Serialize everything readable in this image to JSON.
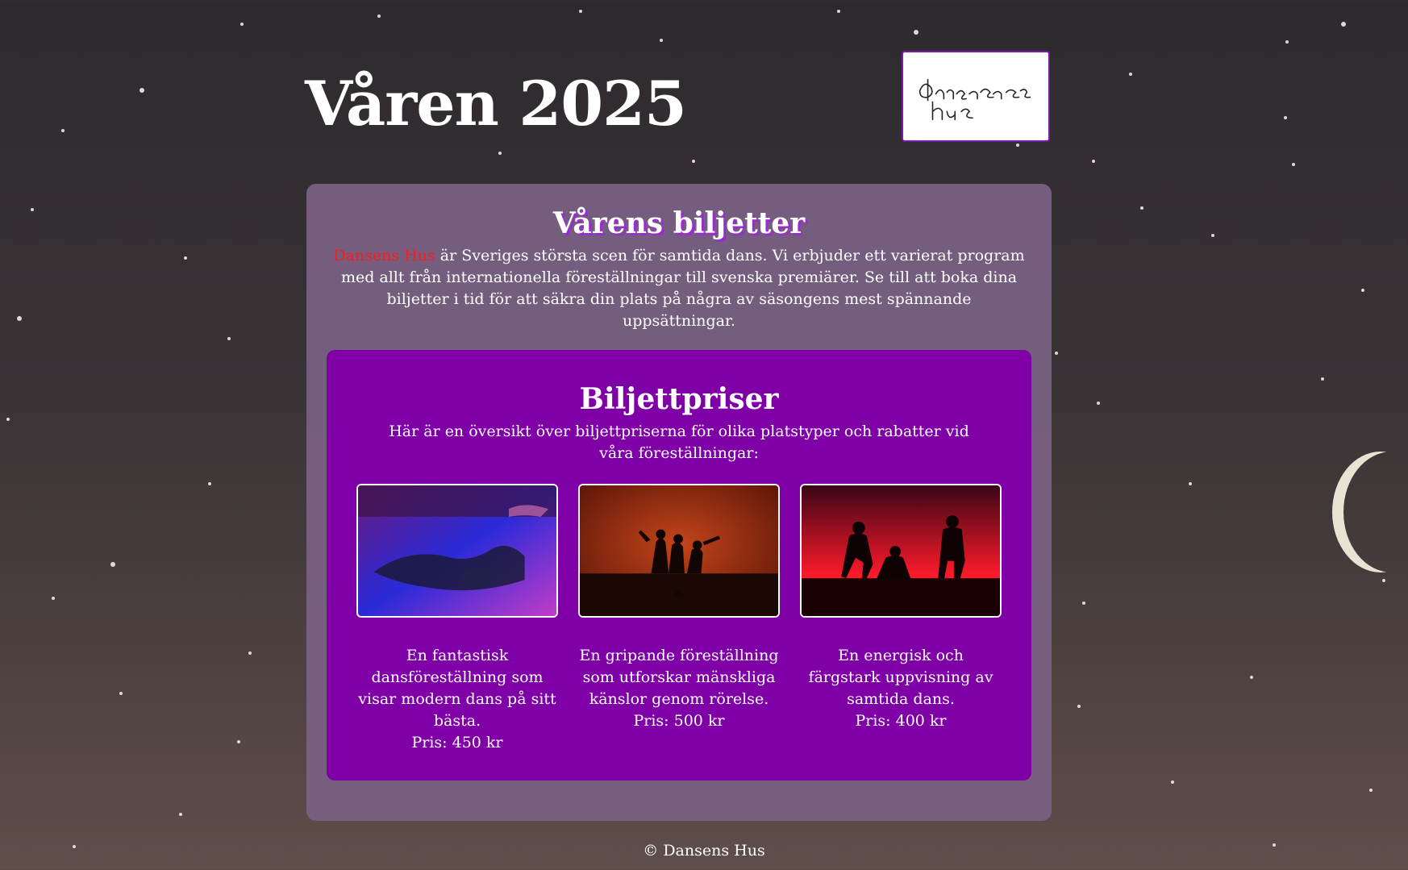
{
  "header": {
    "title": "Våren 2025",
    "logo_text": "dansens hus"
  },
  "tickets": {
    "title": "Vårens biljetter",
    "brand": "Dansens Hus",
    "intro": " är Sveriges största scen för samtida dans. Vi erbjuder ett varierat program med allt från internationella föreställningar till svenska premiärer. Se till att boka dina biljetter i tid för att säkra din plats på några av säsongens mest spännande uppsättningar."
  },
  "prices": {
    "title": "Biljettpriser",
    "intro": "Här är en översikt över biljettpriserna för olika platstyper och rabatter vid våra föreställningar:",
    "shows": [
      {
        "description": "En fantastisk dansföreställning som visar modern dans på sitt bästa.",
        "price": "Pris: 450 kr",
        "image": "dancers-floor-blue-purple"
      },
      {
        "description": "En gripande föreställning som utforskar mänskliga känslor genom rörelse.",
        "price": "Pris: 500 kr",
        "image": "dancers-silhouette-orange-stage"
      },
      {
        "description": "En energisk och färgstark uppvisning av samtida dans.",
        "price": "Pris: 400 kr",
        "image": "dancers-silhouette-red-lights"
      }
    ]
  },
  "footer": {
    "text": "© Dansens Hus"
  },
  "colors": {
    "accent_purple": "#8000a8",
    "card_mauve": "#7a6284",
    "brand_red": "#ff1a1a"
  }
}
